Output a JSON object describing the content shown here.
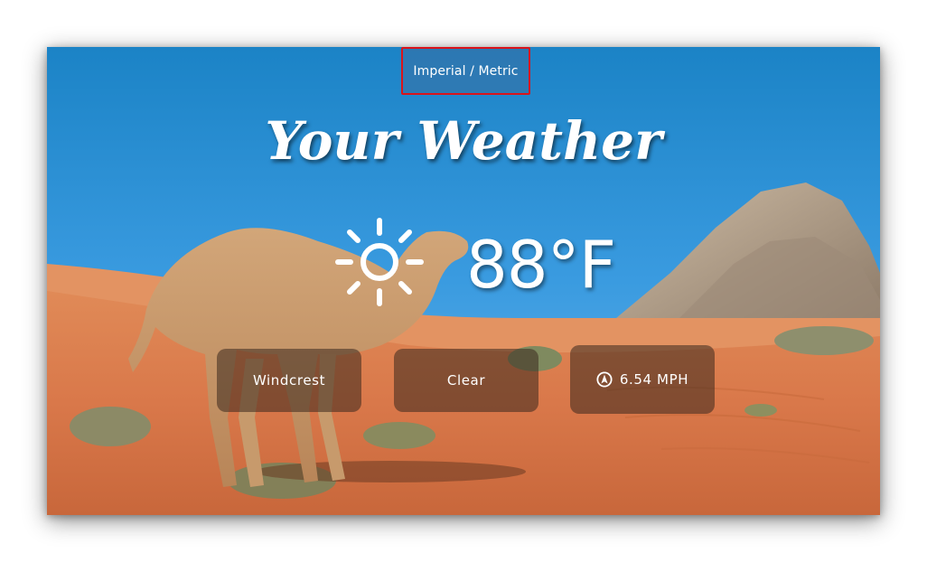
{
  "header": {
    "unit_toggle_label": "Imperial / Metric"
  },
  "title": "Your Weather",
  "current": {
    "temperature": "88°F",
    "icon": "sun-icon"
  },
  "details": {
    "location": "Windcrest",
    "condition": "Clear",
    "wind_icon": "compass-arrow-icon",
    "wind_speed": "6.54 MPH"
  },
  "colors": {
    "toggle_border": "#d9141b",
    "sky_top": "#1b83c6",
    "sand": "#d9784a"
  }
}
